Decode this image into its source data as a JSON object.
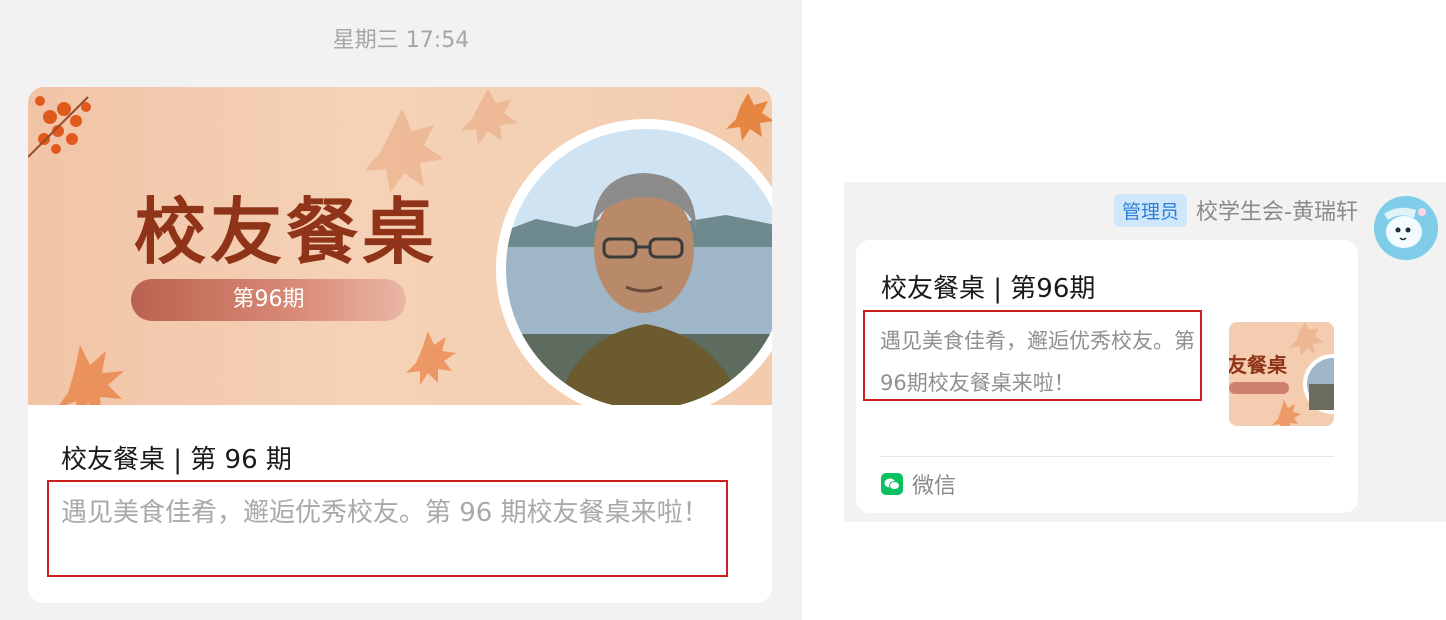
{
  "timestamp": "星期三 17:54",
  "article": {
    "cover_title": "校友餐桌",
    "cover_issue": "第96期",
    "title": "校友餐桌 | 第 96 期",
    "description": "遇见美食佳肴，邂逅优秀校友。第 96 期校友餐桌来啦！"
  },
  "message": {
    "admin_badge": "管理员",
    "sender_name": "校学生会-黄瑞轩",
    "avatar_icon": "cartoon-avatar",
    "link_card": {
      "title": "校友餐桌 | 第96期",
      "description": "遇见美食佳肴，邂逅优秀校友。第96期校友餐桌来啦！",
      "thumb_title": "友餐桌",
      "source_icon": "wechat-icon",
      "source_label": "微信"
    }
  },
  "colors": {
    "highlight_border": "#cc1f1f",
    "cover_title": "#8f3418",
    "admin_badge_bg": "#cfe6fb",
    "admin_badge_text": "#2d7fd6",
    "wechat_green": "#07c160"
  }
}
